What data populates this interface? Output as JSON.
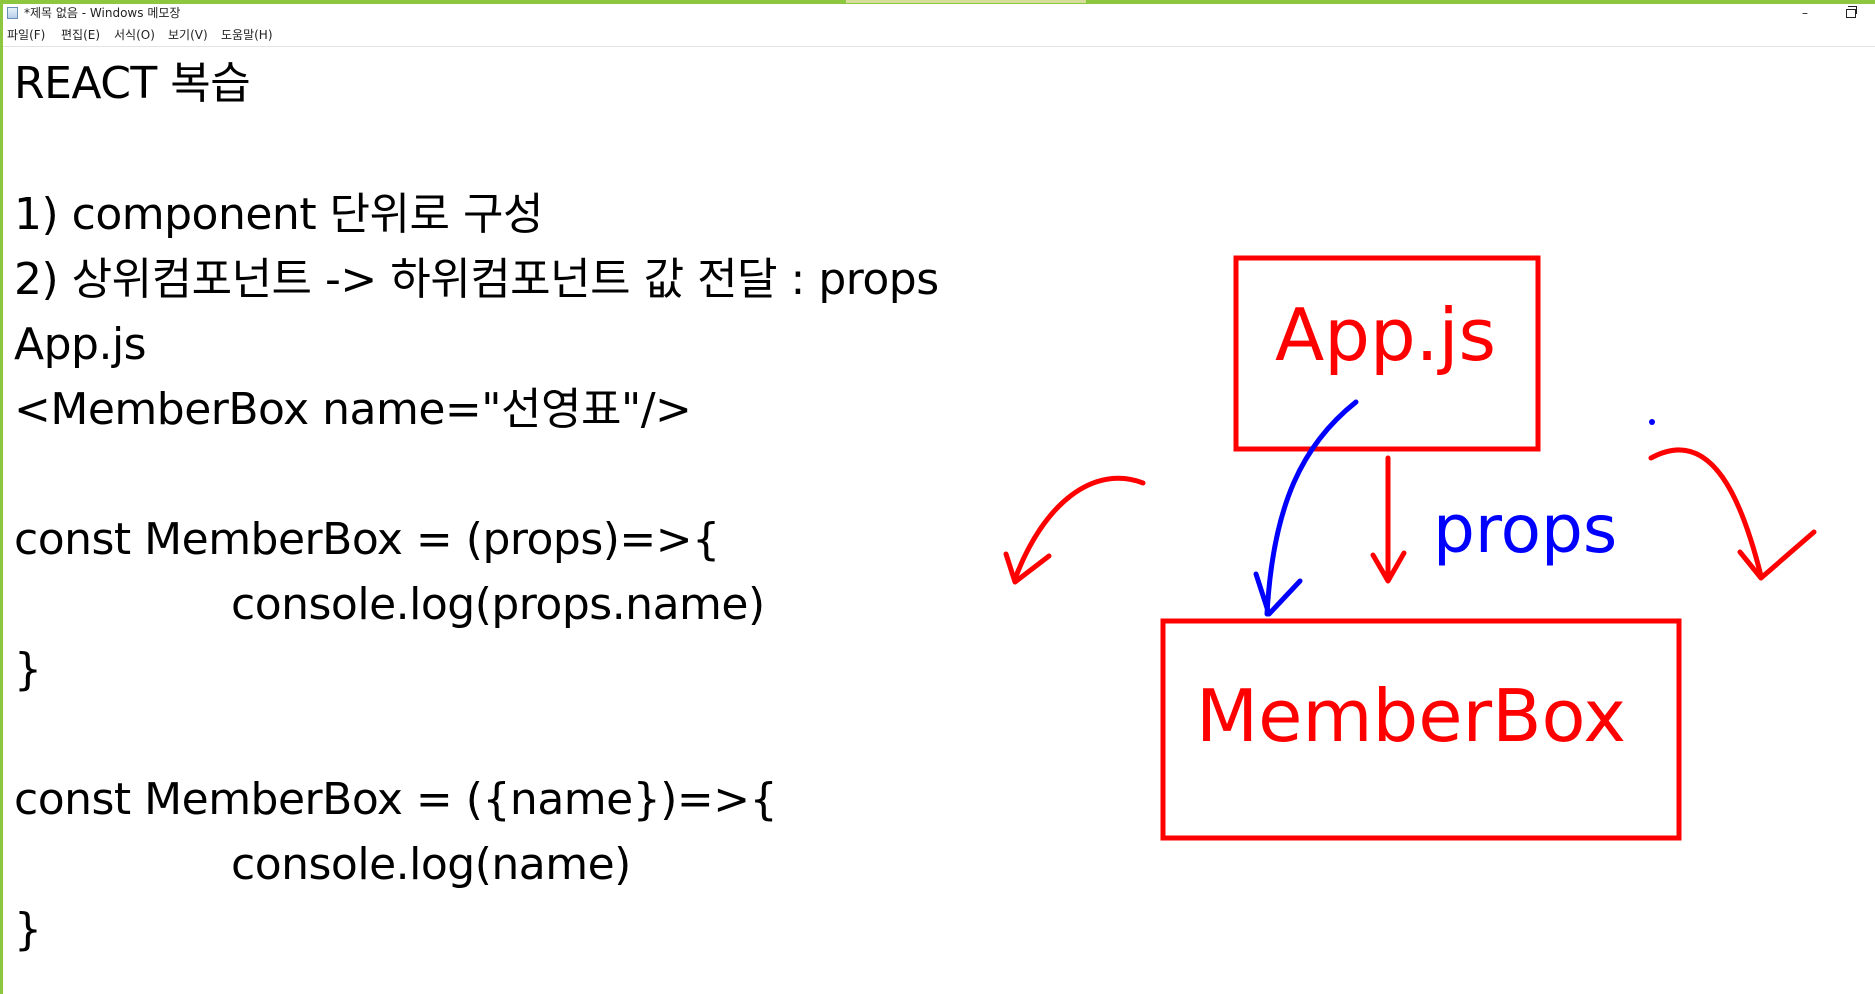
{
  "window": {
    "title": "*제목 없음 - Windows 메모장",
    "minimize_glyph": "–"
  },
  "menu": {
    "items": [
      "파일(F)",
      "편집(E)",
      "서식(O)",
      "보기(V)",
      "도움말(H)"
    ]
  },
  "editor": {
    "lines": [
      "REACT 복습",
      "",
      "1) component 단위로 구성",
      "2) 상위컴포넌트 -> 하위컴포넌트 값 전달 : props",
      "App.js",
      "<MemberBox name=\"선영표\"/>",
      "",
      "const MemberBox = (props)=>{",
      "console.log(props.name)",
      "}",
      "",
      "const MemberBox = ({name})=>{",
      "console.log(name)",
      "}"
    ]
  },
  "drawing": {
    "parent_box_label": "App.js",
    "child_box_label": "MemberBox",
    "arrow_label": "props",
    "colors": {
      "red": "#ff0000",
      "blue": "#0000ff",
      "titlebar_border": "#8dc63f"
    }
  }
}
